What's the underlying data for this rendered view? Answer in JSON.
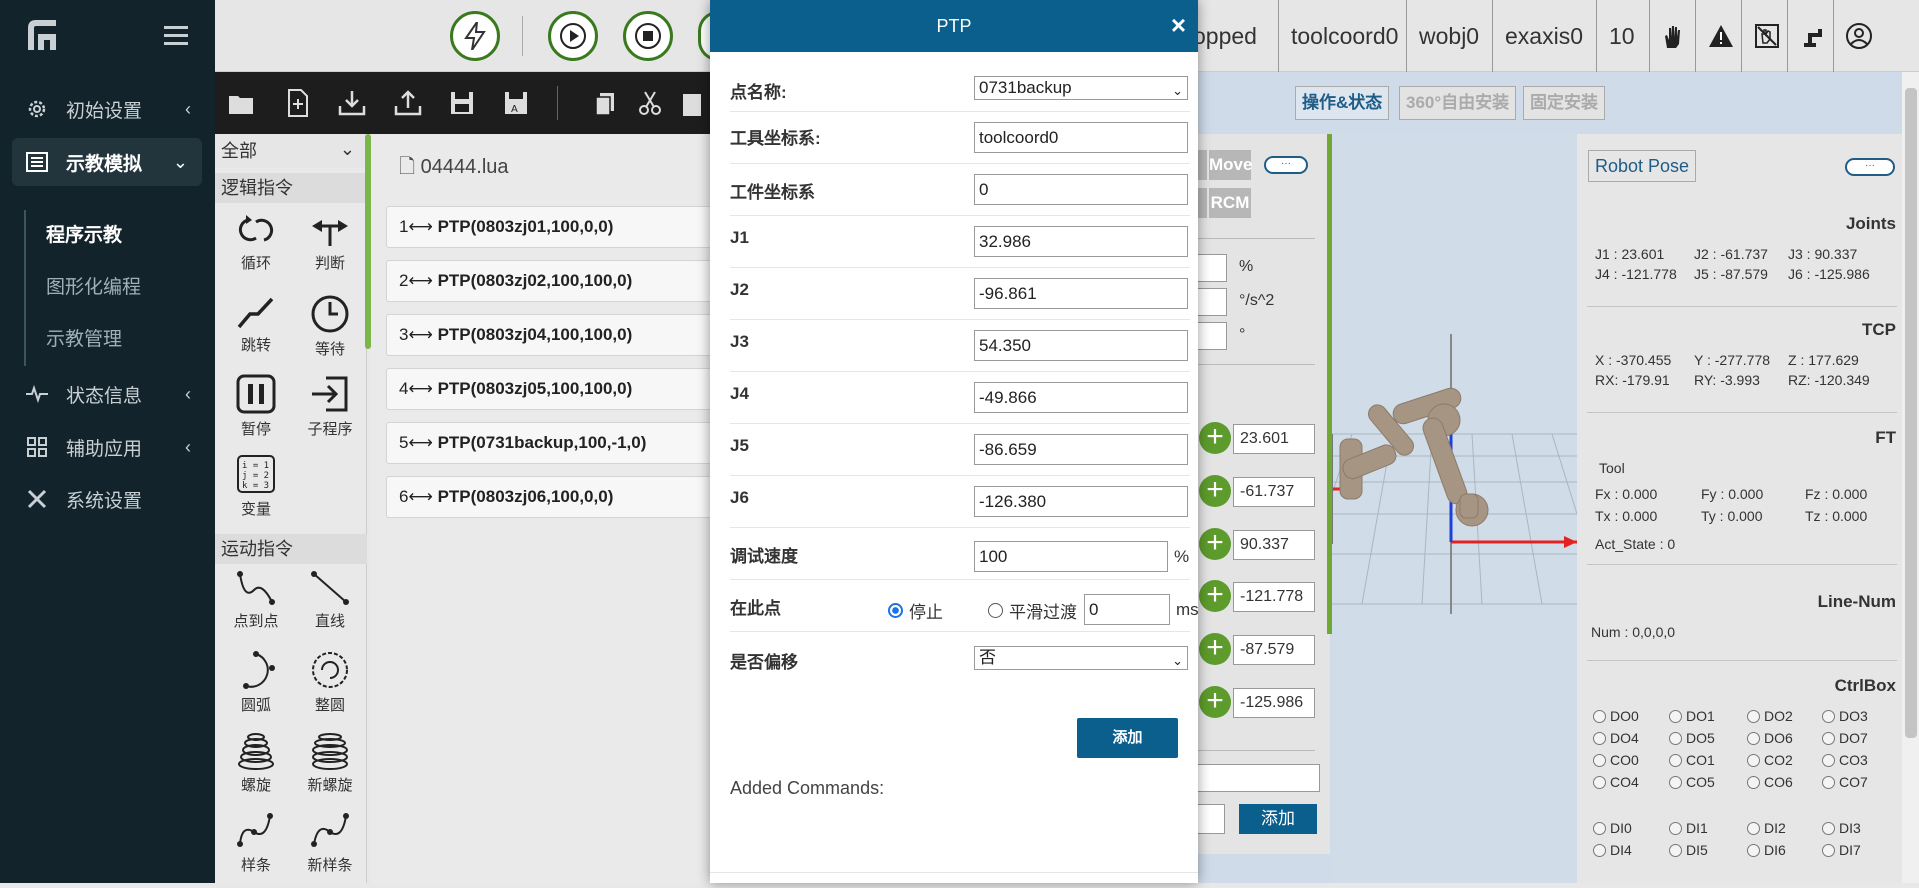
{
  "nav": {
    "items": [
      {
        "label": "初始设置",
        "icon": "gear-icon"
      },
      {
        "label": "示教模拟",
        "icon": "list-icon"
      },
      {
        "label": "状态信息",
        "icon": "pulse-icon"
      },
      {
        "label": "辅助应用",
        "icon": "grid-icon"
      },
      {
        "label": "系统设置",
        "icon": "tools-icon"
      }
    ],
    "sub": [
      "程序示教",
      "图形化编程",
      "示教管理"
    ]
  },
  "status": {
    "state": "opped",
    "tool": "toolcoord0",
    "wobj": "wobj0",
    "exaxis": "exaxis0",
    "speed": "10"
  },
  "palette": {
    "filter": "全部",
    "logic_head": "逻辑指令",
    "logic": [
      "循环",
      "判断",
      "跳转",
      "等待",
      "暂停",
      "子程序",
      "变量"
    ],
    "motion_head": "运动指令",
    "motion": [
      "点到点",
      "直线",
      "圆弧",
      "整圆",
      "螺旋",
      "新螺旋",
      "样条",
      "新样条"
    ]
  },
  "program": {
    "file": "04444.lua",
    "rows": [
      {
        "num": "1",
        "text": "PTP(0803zj01,100,0,0)"
      },
      {
        "num": "2",
        "text": "PTP(0803zj02,100,100,0)"
      },
      {
        "num": "3",
        "text": "PTP(0803zj04,100,100,0)"
      },
      {
        "num": "4",
        "text": "PTP(0803zj05,100,100,0)"
      },
      {
        "num": "5",
        "text": "PTP(0731backup,100,-1,0)"
      },
      {
        "num": "6",
        "text": "PTP(0803zj06,100,0,0)"
      }
    ]
  },
  "tabs": [
    "操作&状态",
    "360°自由安装",
    "固定安装"
  ],
  "jog": {
    "tabs": [
      "Move",
      "RCM"
    ],
    "units": [
      "%",
      "°/s^2",
      "°"
    ],
    "values": [
      "23.601",
      "-61.737",
      "90.337",
      "-121.778",
      "-87.579",
      "-125.986"
    ],
    "add_label": "添加"
  },
  "info": {
    "robot_pose": "Robot Pose",
    "joints_title": "Joints",
    "joints": [
      "J1 : 23.601",
      "J2 : -61.737",
      "J3 : 90.337",
      "J4 : -121.778",
      "J5 : -87.579",
      "J6 : -125.986"
    ],
    "tcp_title": "TCP",
    "tcp": [
      "X  : -370.455",
      "Y  : -277.778",
      "Z  : 177.629",
      "RX: -179.91",
      "RY: -3.993",
      "RZ: -120.349"
    ],
    "ft_title": "FT",
    "ft_tool": "Tool",
    "ft": [
      "Fx : 0.000",
      "Fy : 0.000",
      "Fz : 0.000",
      "Tx : 0.000",
      "Ty : 0.000",
      "Tz : 0.000"
    ],
    "act_state": "Act_State : 0",
    "linenum_title": "Line-Num",
    "num": "Num  :   0,0,0,0",
    "ctrlbox_title": "CtrlBox",
    "ctrl": [
      "DO0",
      "DO1",
      "DO2",
      "DO3",
      "DO4",
      "DO5",
      "DO6",
      "DO7",
      "CO0",
      "CO1",
      "CO2",
      "CO3",
      "CO4",
      "CO5",
      "CO6",
      "CO7",
      "DI0",
      "DI1",
      "DI2",
      "DI3",
      "DI4",
      "DI5",
      "DI6",
      "DI7"
    ]
  },
  "modal": {
    "title": "PTP",
    "close": "×",
    "point_label": "点名称:",
    "point_value": "0731backup",
    "tool_label": "工具坐标系:",
    "tool_value": "toolcoord0",
    "wobj_label": "工件坐标系",
    "wobj_value": "0",
    "joints": [
      {
        "label": "J1",
        "value": "32.986"
      },
      {
        "label": "J2",
        "value": "-96.861"
      },
      {
        "label": "J3",
        "value": "54.350"
      },
      {
        "label": "J4",
        "value": "-49.866"
      },
      {
        "label": "J5",
        "value": "-86.659"
      },
      {
        "label": "J6",
        "value": "-126.380"
      }
    ],
    "speed_label": "调试速度",
    "speed_value": "100",
    "speed_unit": "%",
    "at_point_label": "在此点",
    "stop_label": "停止",
    "smooth_label": "平滑过渡",
    "smooth_value": "0",
    "smooth_unit": "ms",
    "offset_label": "是否偏移",
    "offset_value": "否",
    "add_label": "添加",
    "added_label": "Added Commands:"
  }
}
